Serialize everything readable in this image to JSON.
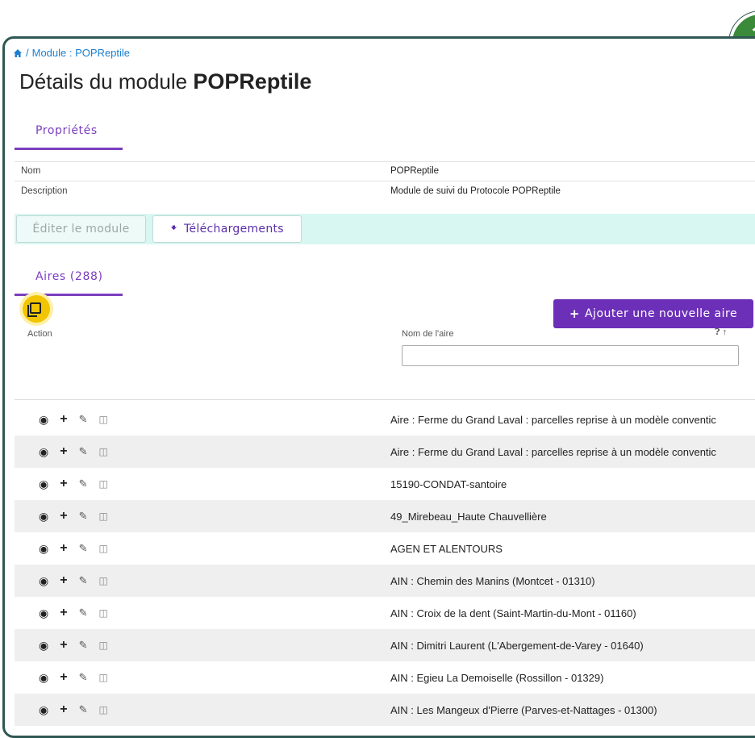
{
  "breadcrumb": {
    "separator": "/",
    "current": "Module : POPReptile"
  },
  "page": {
    "title_prefix": "Détails du module",
    "title_name": "POPReptile"
  },
  "properties_tab": {
    "label": "Propriétés"
  },
  "properties": [
    {
      "label": "Nom",
      "value": "POPReptile"
    },
    {
      "label": "Description",
      "value": "Module de suivi du Protocole POPReptile"
    }
  ],
  "toolbar": {
    "edit_label": "Éditer le module",
    "download_label": "Téléchargements",
    "download_icon": "arrow-down-icon"
  },
  "sites_tab": {
    "label": "Aires (288)"
  },
  "add_button": {
    "label": "Ajouter une nouvelle aire",
    "icon": "plus-icon"
  },
  "table": {
    "columns": {
      "action": "Action",
      "name": "Nom de l'aire"
    },
    "filter_value": "",
    "rows": [
      {
        "name": "Aire : Ferme du Grand Laval : parcelles reprise à un modèle conventic"
      },
      {
        "name": "Aire : Ferme du Grand Laval : parcelles reprise à un modèle conventic"
      },
      {
        "name": "15190-CONDAT-santoire"
      },
      {
        "name": "49_Mirebeau_Haute Chauvellière"
      },
      {
        "name": "AGEN ET ALENTOURS"
      },
      {
        "name": "AIN : Chemin des Manins (Montcet - 01310)"
      },
      {
        "name": "AIN : Croix de la dent (Saint-Martin-du-Mont - 01160)"
      },
      {
        "name": "AIN : Dimitri Laurent (L'Abergement-de-Varey - 01640)"
      },
      {
        "name": "AIN : Egieu La Demoiselle (Rossillon - 01329)"
      },
      {
        "name": "AIN : Les Mangeux d'Pierre (Parves-et-Nattages - 01300)"
      }
    ]
  },
  "colors": {
    "accent": "#7a3fbf",
    "primary_button": "#6c2fb8",
    "link": "#1a7fd1",
    "toolbar_band": "#d9f7f2",
    "frame": "#2f5753"
  }
}
